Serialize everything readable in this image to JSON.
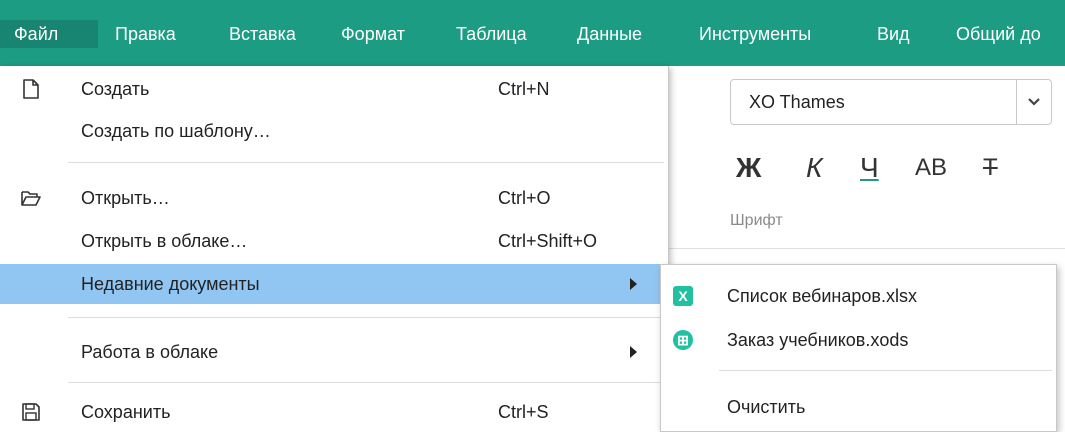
{
  "menubar": {
    "items": [
      {
        "label": "Файл"
      },
      {
        "label": "Правка"
      },
      {
        "label": "Вставка"
      },
      {
        "label": "Формат"
      },
      {
        "label": "Таблица"
      },
      {
        "label": "Данные"
      },
      {
        "label": "Инструменты"
      },
      {
        "label": "Вид"
      },
      {
        "label": "Общий до"
      }
    ]
  },
  "toolbar": {
    "font_value": "XO Thames",
    "bold": "Ж",
    "italic": "К",
    "underline": "Ч",
    "caps": "АВ",
    "strike": "Т",
    "group_label": "Шрифт"
  },
  "file_menu": {
    "items": [
      {
        "label": "Создать",
        "shortcut": "Ctrl+N",
        "icon": "new-document-icon"
      },
      {
        "label": "Создать по шаблону…",
        "shortcut": ""
      },
      {
        "label": "Открыть…",
        "shortcut": "Ctrl+O",
        "icon": "open-folder-icon"
      },
      {
        "label": "Открыть в облаке…",
        "shortcut": "Ctrl+Shift+O"
      },
      {
        "label": "Недавние документы",
        "shortcut": "",
        "submenu": true
      },
      {
        "label": "Работа в облаке",
        "shortcut": "",
        "submenu": true
      },
      {
        "label": "Сохранить",
        "shortcut": "Ctrl+S",
        "icon": "save-icon"
      }
    ]
  },
  "recent_submenu": {
    "items": [
      {
        "label": "Список вебинаров.xlsx",
        "icon": "xlsx-file-icon",
        "icon_glyph": "X",
        "icon_color": "#21c0a0"
      },
      {
        "label": "Заказ учебников.xods",
        "icon": "xods-file-icon",
        "icon_glyph": "⊞",
        "icon_color": "#21c0a0"
      }
    ],
    "clear_label": "Очистить"
  },
  "colors": {
    "menubar_bg": "#1d9c84",
    "highlight": "#92c6f2",
    "file_icon": "#21c0a0"
  }
}
